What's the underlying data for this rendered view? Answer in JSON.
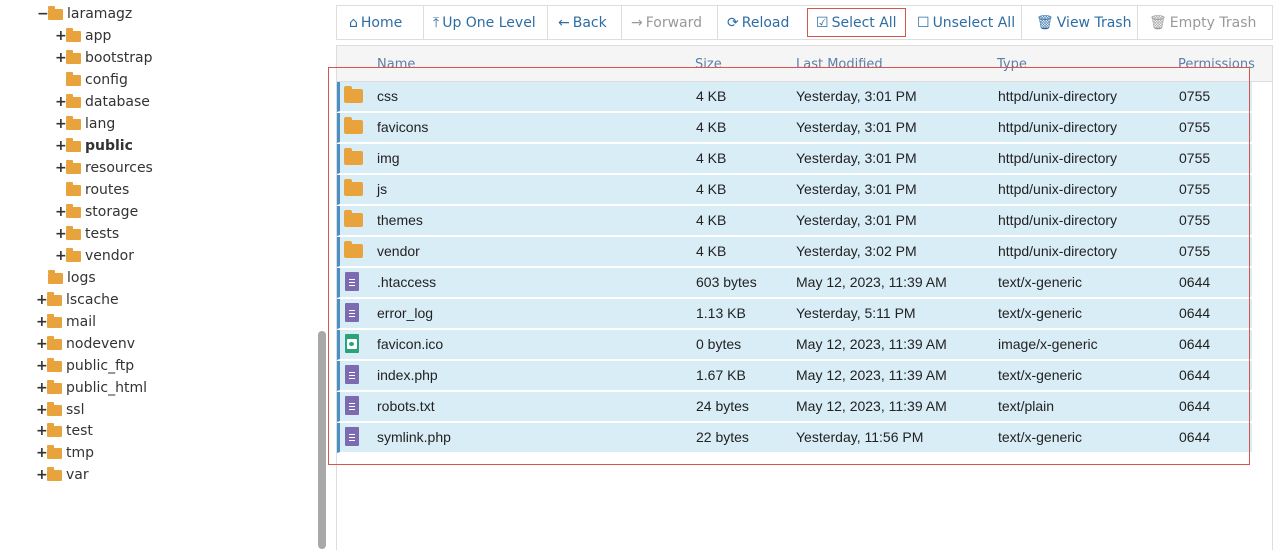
{
  "tree": {
    "items": [
      {
        "label": "laramagz",
        "toggle": "−",
        "bold": false
      },
      {
        "label": "app",
        "toggle": "+",
        "bold": false
      },
      {
        "label": "bootstrap",
        "toggle": "+",
        "bold": false
      },
      {
        "label": "config",
        "toggle": "",
        "bold": false
      },
      {
        "label": "database",
        "toggle": "+",
        "bold": false
      },
      {
        "label": "lang",
        "toggle": "+",
        "bold": false
      },
      {
        "label": "public",
        "toggle": "+",
        "bold": true
      },
      {
        "label": "resources",
        "toggle": "+",
        "bold": false
      },
      {
        "label": "routes",
        "toggle": "",
        "bold": false
      },
      {
        "label": "storage",
        "toggle": "+",
        "bold": false
      },
      {
        "label": "tests",
        "toggle": "+",
        "bold": false
      },
      {
        "label": "vendor",
        "toggle": "+",
        "bold": false
      },
      {
        "label": "logs",
        "toggle": "",
        "bold": false
      },
      {
        "label": "lscache",
        "toggle": "+",
        "bold": false
      },
      {
        "label": "mail",
        "toggle": "+",
        "bold": false
      },
      {
        "label": "nodevenv",
        "toggle": "+",
        "bold": false
      },
      {
        "label": "public_ftp",
        "toggle": "+",
        "bold": false
      },
      {
        "label": "public_html",
        "toggle": "+",
        "bold": false
      },
      {
        "label": "ssl",
        "toggle": "+",
        "bold": false
      },
      {
        "label": "test",
        "toggle": "+",
        "bold": false
      },
      {
        "label": "tmp",
        "toggle": "+",
        "bold": false
      },
      {
        "label": "var",
        "toggle": "+",
        "bold": false
      }
    ]
  },
  "toolbar": {
    "home": {
      "label": "Home",
      "icon": "home-icon"
    },
    "up": {
      "label": "Up One Level",
      "icon": "level-up-icon"
    },
    "back": {
      "label": "Back",
      "icon": "arrow-left-icon"
    },
    "forward": {
      "label": "Forward",
      "icon": "arrow-right-icon"
    },
    "reload": {
      "label": "Reload",
      "icon": "refresh-icon"
    },
    "select_all": {
      "label": "Select All",
      "icon": "checkbox-checked-icon"
    },
    "unselect_all": {
      "label": "Unselect All",
      "icon": "checkbox-empty-icon"
    },
    "view_trash": {
      "label": "View Trash",
      "icon": "trash-icon"
    },
    "empty_trash": {
      "label": "Empty Trash",
      "icon": "trash-icon"
    }
  },
  "table": {
    "columns": {
      "name": "Name",
      "size": "Size",
      "modified": "Last Modified",
      "type": "Type",
      "perms": "Permissions"
    },
    "rows": [
      {
        "icon": "folder",
        "name": "css",
        "size": "4 KB",
        "modified": "Yesterday, 3:01 PM",
        "type": "httpd/unix-directory",
        "perms": "0755"
      },
      {
        "icon": "folder",
        "name": "favicons",
        "size": "4 KB",
        "modified": "Yesterday, 3:01 PM",
        "type": "httpd/unix-directory",
        "perms": "0755"
      },
      {
        "icon": "folder",
        "name": "img",
        "size": "4 KB",
        "modified": "Yesterday, 3:01 PM",
        "type": "httpd/unix-directory",
        "perms": "0755"
      },
      {
        "icon": "folder",
        "name": "js",
        "size": "4 KB",
        "modified": "Yesterday, 3:01 PM",
        "type": "httpd/unix-directory",
        "perms": "0755"
      },
      {
        "icon": "folder",
        "name": "themes",
        "size": "4 KB",
        "modified": "Yesterday, 3:01 PM",
        "type": "httpd/unix-directory",
        "perms": "0755"
      },
      {
        "icon": "folder",
        "name": "vendor",
        "size": "4 KB",
        "modified": "Yesterday, 3:02 PM",
        "type": "httpd/unix-directory",
        "perms": "0755"
      },
      {
        "icon": "doc",
        "name": ".htaccess",
        "size": "603 bytes",
        "modified": "May 12, 2023, 11:39 AM",
        "type": "text/x-generic",
        "perms": "0644"
      },
      {
        "icon": "doc",
        "name": "error_log",
        "size": "1.13 KB",
        "modified": "Yesterday, 5:11 PM",
        "type": "text/x-generic",
        "perms": "0644"
      },
      {
        "icon": "img",
        "name": "favicon.ico",
        "size": "0 bytes",
        "modified": "May 12, 2023, 11:39 AM",
        "type": "image/x-generic",
        "perms": "0644"
      },
      {
        "icon": "doc",
        "name": "index.php",
        "size": "1.67 KB",
        "modified": "May 12, 2023, 11:39 AM",
        "type": "text/x-generic",
        "perms": "0644"
      },
      {
        "icon": "doc",
        "name": "robots.txt",
        "size": "24 bytes",
        "modified": "May 12, 2023, 11:39 AM",
        "type": "text/plain",
        "perms": "0644"
      },
      {
        "icon": "doc",
        "name": "symlink.php",
        "size": "22 bytes",
        "modified": "Yesterday, 11:56 PM",
        "type": "text/x-generic",
        "perms": "0644"
      }
    ]
  },
  "colors": {
    "accent": "#2e6da4",
    "selected_row": "#d9edf7",
    "highlight_box": "#d9534f",
    "folder": "#e8a33c"
  }
}
